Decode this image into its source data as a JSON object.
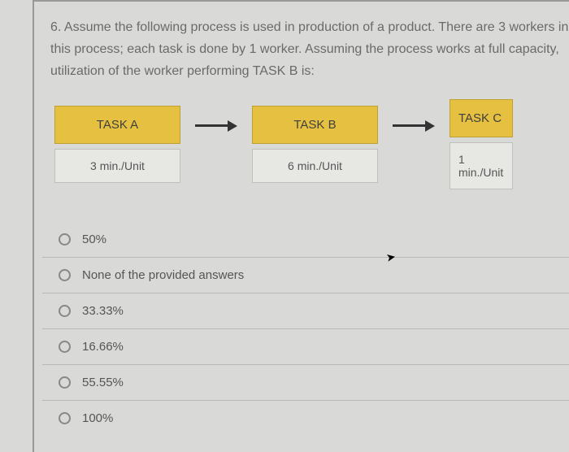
{
  "question": {
    "number": "6.",
    "text": "Assume the following process is used in production of a product. There are 3 workers in this process; each task is done by 1 worker. Assuming the process works at full capacity, utilization of the worker performing TASK B is:"
  },
  "tasks": [
    {
      "name": "TASK A",
      "rate": "3 min./Unit"
    },
    {
      "name": "TASK B",
      "rate": "6 min./Unit"
    },
    {
      "name": "TASK C",
      "rate": "1 min./Unit"
    }
  ],
  "options": [
    {
      "label": "50%"
    },
    {
      "label": "None of the provided answers"
    },
    {
      "label": "33.33%"
    },
    {
      "label": "16.66%"
    },
    {
      "label": "55.55%"
    },
    {
      "label": "100%"
    }
  ]
}
